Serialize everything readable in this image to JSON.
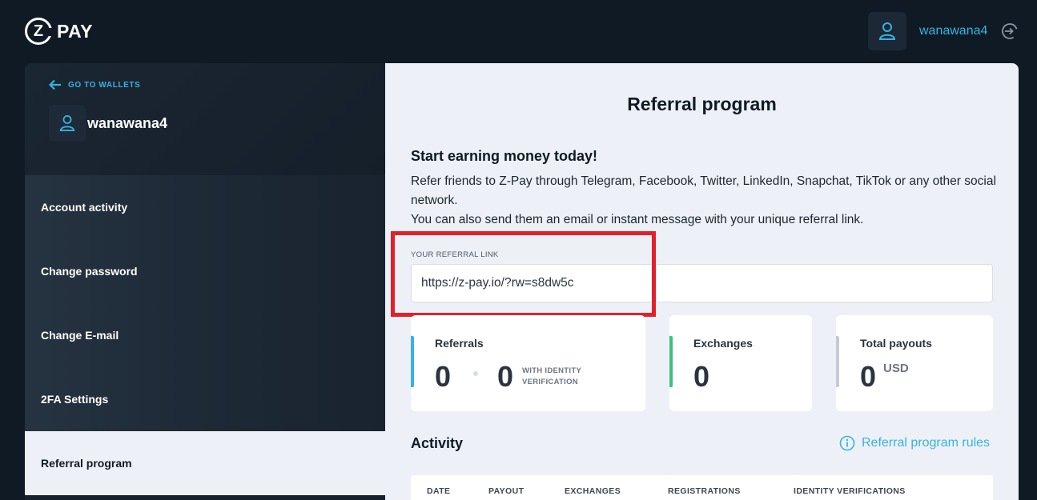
{
  "header": {
    "logo_mark": "Z",
    "logo_text": "PAY",
    "username": "wanawana4"
  },
  "sidebar": {
    "back_label": "GO TO WALLETS",
    "username": "wanawana4",
    "items": [
      {
        "label": "Account activity"
      },
      {
        "label": "Change password"
      },
      {
        "label": "Change E-mail"
      },
      {
        "label": "2FA Settings"
      },
      {
        "label": "Referral program",
        "active": true
      }
    ]
  },
  "main": {
    "title": "Referral program",
    "intro_title": "Start earning money today!",
    "intro_line1": "Refer friends to Z-Pay through Telegram, Facebook, Twitter, LinkedIn, Snapchat, TikTok or any other social network.",
    "intro_line2": "You can also send them an email or instant message with your unique referral link.",
    "referral_label": "YOUR REFERRAL LINK",
    "referral_link": "https://z-pay.io/?rw=s8dw5c",
    "stats": {
      "referrals": {
        "title": "Referrals",
        "count": "0",
        "verified": "0",
        "verified_label": "WITH IDENTITY VERIFICATION",
        "accent": "#36b3e0"
      },
      "exchanges": {
        "title": "Exchanges",
        "count": "0",
        "accent": "#3fbf7f"
      },
      "payouts": {
        "title": "Total payouts",
        "amount": "0",
        "unit": "USD",
        "accent": "#c2ccd6"
      }
    },
    "activity_title": "Activity",
    "rules_label": "Referral program rules",
    "table_headers": [
      "DATE",
      "PAYOUT",
      "EXCHANGES",
      "REGISTRATIONS",
      "IDENTITY VERIFICATIONS"
    ]
  },
  "colors": {
    "accent": "#36b3e0",
    "highlight": "#e3202a",
    "background": "#0f1a25"
  }
}
